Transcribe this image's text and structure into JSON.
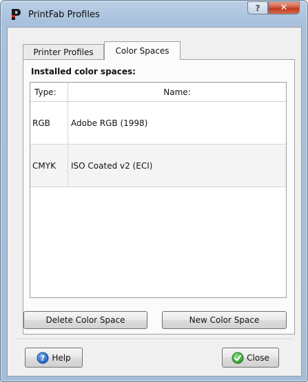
{
  "window": {
    "title": "PrintFab Profiles",
    "help_glyph": "?",
    "close_glyph": "✕"
  },
  "tabs": [
    {
      "label": "Printer Profiles",
      "active": false
    },
    {
      "label": "Color Spaces",
      "active": true
    }
  ],
  "color_spaces": {
    "section_label": "Installed color spaces:",
    "columns": {
      "type": "Type:",
      "name": "Name:"
    },
    "rows": [
      {
        "type": "RGB",
        "name": "Adobe RGB (1998)"
      },
      {
        "type": "CMYK",
        "name": "ISO Coated v2 (ECI)"
      }
    ],
    "delete_label": "Delete Color Space",
    "new_label": "New Color Space"
  },
  "footer": {
    "help_label": "Help",
    "close_label": "Close"
  },
  "icons": {
    "app": "printfab-p-icon",
    "help": "help-icon",
    "close": "check-icon"
  }
}
